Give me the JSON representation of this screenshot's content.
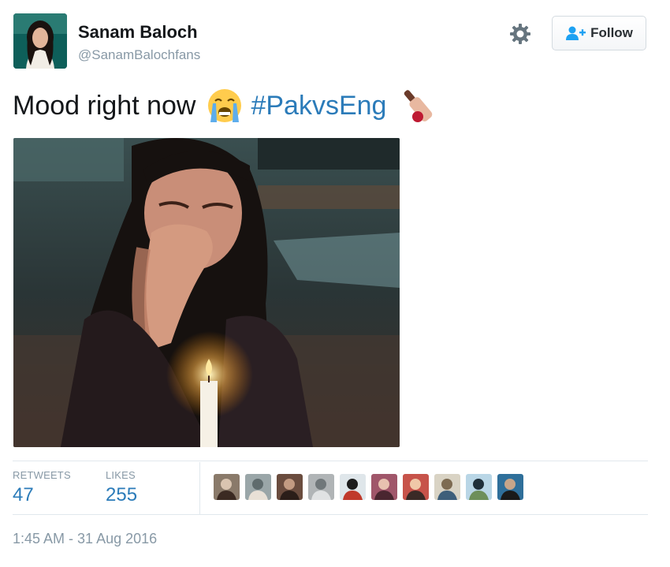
{
  "user": {
    "display_name": "Sanam Baloch",
    "handle": "@SanamBalochfans",
    "avatar_icon": "profile-photo"
  },
  "actions": {
    "settings_icon": "gear-icon",
    "follow_label": "Follow",
    "follow_icon": "add-user-icon"
  },
  "tweet": {
    "text": "Mood right now",
    "emoji_1": "loudly-crying-face-icon",
    "hashtag": "#PakvsEng",
    "emoji_2": "cricket-bat-icon"
  },
  "media": {
    "description_icon": "crying-woman-candle-photo"
  },
  "stats": {
    "retweets_label": "RETWEETS",
    "retweets_count": "47",
    "likes_label": "LIKES",
    "likes_count": "255"
  },
  "likers_count": 10,
  "timestamp": "1:45 AM - 31 Aug 2016",
  "colors": {
    "link": "#2b7bb9",
    "muted": "#8899a6",
    "text": "#14171a",
    "divider": "#e1e8ed"
  }
}
